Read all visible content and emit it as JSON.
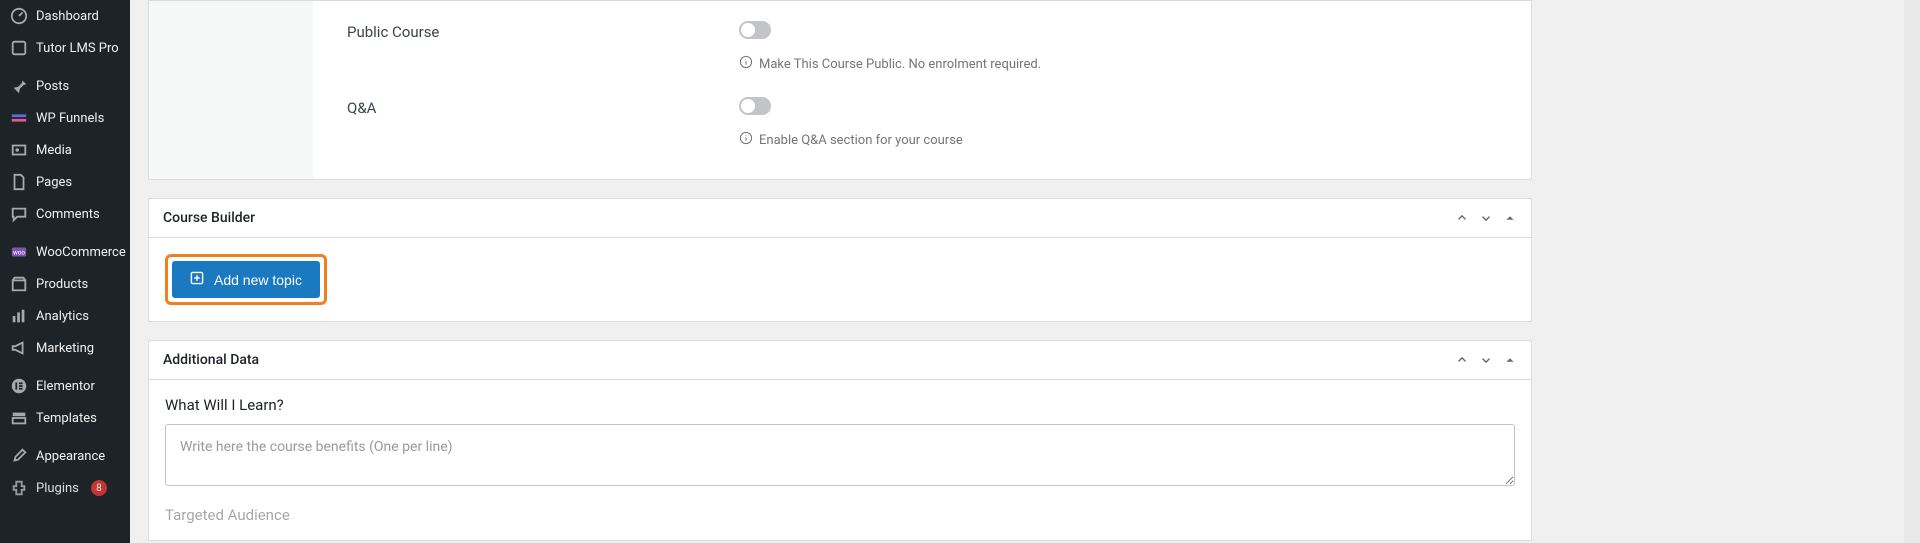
{
  "sidebar": {
    "items": [
      {
        "label": "Dashboard"
      },
      {
        "label": "Tutor LMS Pro"
      },
      {
        "label": "Posts"
      },
      {
        "label": "WP Funnels"
      },
      {
        "label": "Media"
      },
      {
        "label": "Pages"
      },
      {
        "label": "Comments"
      },
      {
        "label": "WooCommerce"
      },
      {
        "label": "Products"
      },
      {
        "label": "Analytics"
      },
      {
        "label": "Marketing"
      },
      {
        "label": "Elementor"
      },
      {
        "label": "Templates"
      },
      {
        "label": "Appearance"
      },
      {
        "label": "Plugins",
        "badge": "8"
      }
    ]
  },
  "settings": {
    "public_course": {
      "label": "Public Course",
      "helper": "Make This Course Public. No enrolment required."
    },
    "qa": {
      "label": "Q&A",
      "helper": "Enable Q&A section for your course"
    }
  },
  "course_builder": {
    "title": "Course Builder",
    "add_topic_label": "Add new topic"
  },
  "additional": {
    "title": "Additional Data",
    "what_learn_label": "What Will I Learn?",
    "what_learn_placeholder": "Write here the course benefits (One per line)",
    "audience_label": "Targeted Audience"
  }
}
